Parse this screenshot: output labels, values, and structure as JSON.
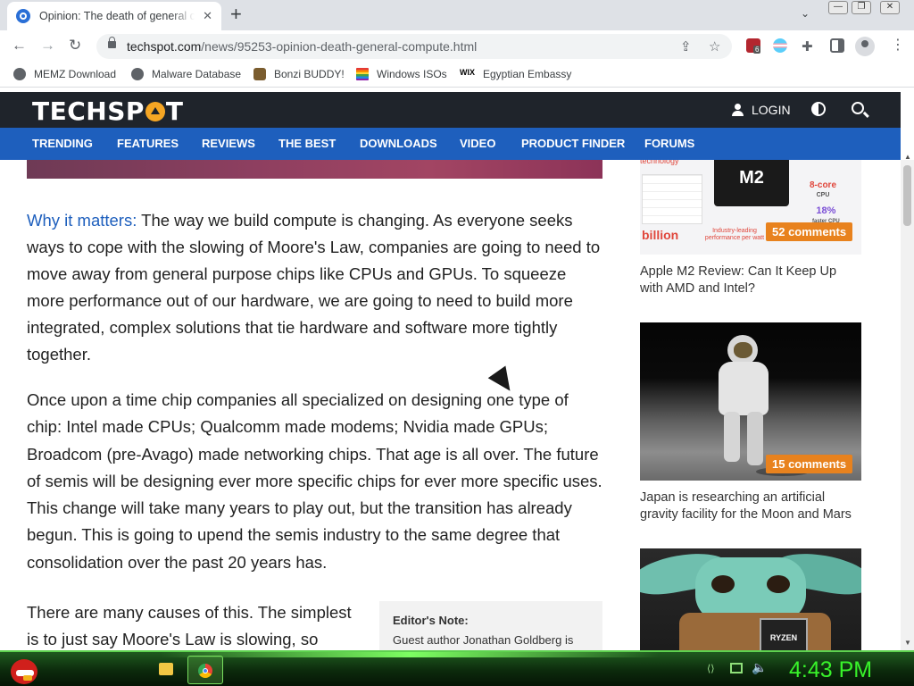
{
  "browser": {
    "tab_title": "Opinion: The death of general compute",
    "url_host": "techspot.com",
    "url_path": "/news/95253-opinion-death-general-compute.html",
    "extension_badge": "6"
  },
  "bookmarks": [
    {
      "label": "MEMZ Download",
      "icon": "globe-icon"
    },
    {
      "label": "Malware Database",
      "icon": "globe-icon"
    },
    {
      "label": "Bonzi BUDDY!",
      "icon": "bonzi-icon"
    },
    {
      "label": "Windows ISOs",
      "icon": "windows-flag-icon"
    },
    {
      "label": "Egyptian Embassy",
      "icon": "wix-icon"
    }
  ],
  "site": {
    "logo": "TECHSPOT",
    "login": "LOGIN",
    "nav": [
      "TRENDING",
      "FEATURES",
      "REVIEWS",
      "THE BEST",
      "DOWNLOADS",
      "VIDEO",
      "PRODUCT FINDER",
      "FORUMS"
    ]
  },
  "article": {
    "p1_lead": "Why it matters:",
    "p1_body": " The way we build compute is changing. As everyone seeks ways to cope with the slowing of Moore's Law, companies are going to need to move away from general purpose chips like CPUs and GPUs. To squeeze more performance out of our hardware, we are going to need to build more integrated, complex solutions that tie hardware and software more tightly together.",
    "p2": "Once upon a time chip companies all specialized on designing one type of chip: Intel made CPUs; Qualcomm made modems; Nvidia made GPUs; Broadcom (pre-Avago) made networking chips. That age is all over. The future of semis will be designing ever more specific chips for ever more specific uses. This change will take many years to play out, but the transition has already begun. This is going to upend the semis industry to the same degree that consolidation over the past 20 years has.",
    "p3": "There are many causes of this. The simplest is to just say Moore's Law is slowing, so",
    "editor_note_title": "Editor's Note:",
    "editor_note_text": "Guest author Jonathan Goldberg is"
  },
  "sidebar": [
    {
      "comments": "52 comments",
      "title": "Apple M2 Review: Can It Keep Up with AMD and Intel?",
      "image_text": {
        "chip": "M2",
        "tech": "technology",
        "cores": "8-core",
        "cores_sub": "CPU",
        "pct": "18%",
        "pct_sub": "faster CPU",
        "billion": "billion",
        "perf": "Industry-leading performance per watt"
      }
    },
    {
      "comments": "15 comments",
      "title": "Japan is researching an artificial gravity facility for the Moon and Mars"
    },
    {
      "comments": "",
      "title": "",
      "image_text": {
        "chip": "RYZEN"
      }
    }
  ],
  "taskbar": {
    "clock": "4:43 PM"
  }
}
